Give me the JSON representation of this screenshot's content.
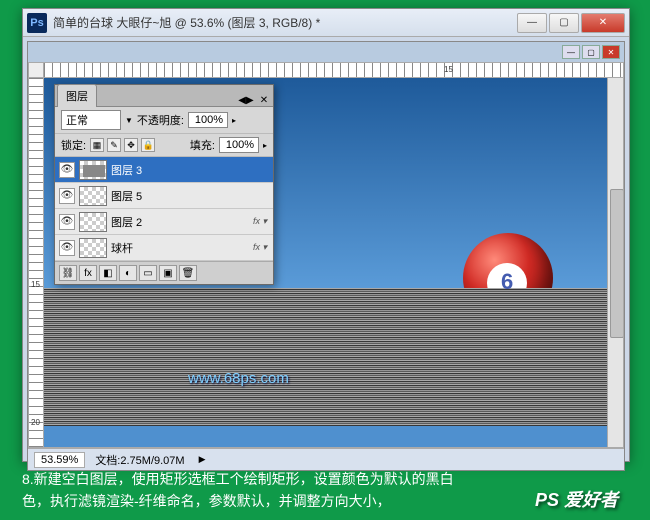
{
  "app_icon_text": "Ps",
  "window_title": "简单的台球   大眼仔~旭 @ 53.6% (图层 3, RGB/8) *",
  "layers_panel": {
    "tab": "图层",
    "blend_mode": "正常",
    "opacity_label": "不透明度:",
    "opacity_value": "100%",
    "lock_label": "锁定:",
    "fill_label": "填充:",
    "fill_value": "100%",
    "layers": [
      {
        "name": "图层 3",
        "selected": true,
        "fx": false
      },
      {
        "name": "图层 5",
        "selected": false,
        "fx": false
      },
      {
        "name": "图层 2",
        "selected": false,
        "fx": true
      },
      {
        "name": "球杆",
        "selected": false,
        "fx": true
      }
    ]
  },
  "ball_number": "6",
  "watermark": "www.68ps.com",
  "status": {
    "zoom": "53.59%",
    "doc": "文档:2.75M/9.07M"
  },
  "ruler_marks": {
    "top": "15",
    "side1": "15",
    "side2": "20"
  },
  "caption_line1": "8.新建空白图层，使用矩形选框工个绘制矩形，设置颜色为默认的黑白",
  "caption_line2": "色，执行滤镜渲染-纤维命名，参数默认，并调整方向大小，",
  "brand": "PS 爱好者"
}
